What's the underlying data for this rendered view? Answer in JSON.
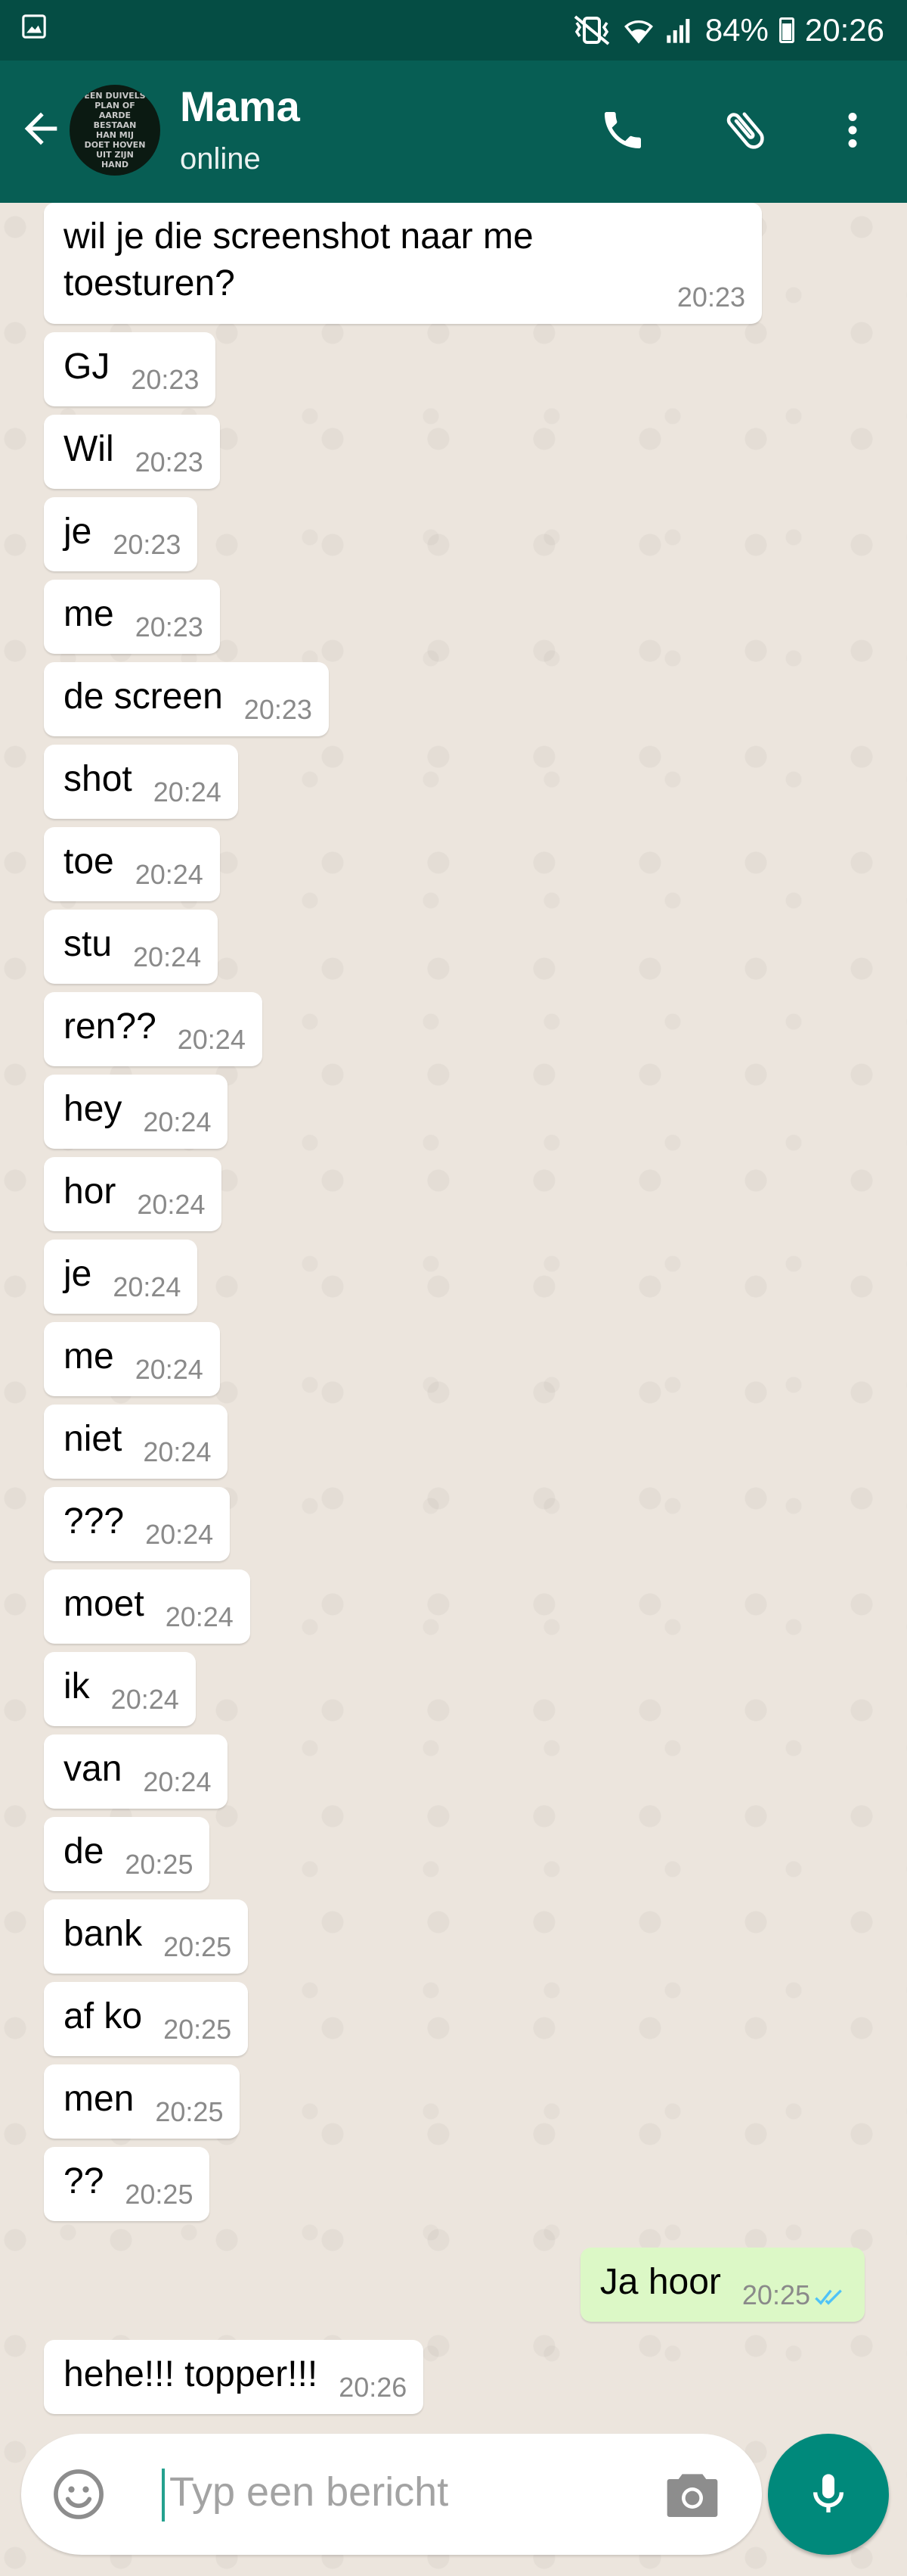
{
  "status_bar": {
    "battery": "84%",
    "time": "20:26"
  },
  "header": {
    "avatar_text": "EEN DUIVELS PLAN OF AARDE BESTAAN HAN MIJ DOET HOVEN UIT ZIJN HAND",
    "title": "Mama",
    "status": "online"
  },
  "messages": [
    {
      "dir": "in",
      "text": "wil je die screenshot naar me\ntoesturen?",
      "time": "20:23"
    },
    {
      "dir": "in",
      "text": "GJ",
      "time": "20:23"
    },
    {
      "dir": "in",
      "text": "Wil",
      "time": "20:23"
    },
    {
      "dir": "in",
      "text": "je",
      "time": "20:23"
    },
    {
      "dir": "in",
      "text": "me",
      "time": "20:23"
    },
    {
      "dir": "in",
      "text": "de screen",
      "time": "20:23"
    },
    {
      "dir": "in",
      "text": "shot",
      "time": "20:24"
    },
    {
      "dir": "in",
      "text": "toe",
      "time": "20:24"
    },
    {
      "dir": "in",
      "text": "stu",
      "time": "20:24"
    },
    {
      "dir": "in",
      "text": "ren??",
      "time": "20:24"
    },
    {
      "dir": "in",
      "text": "hey",
      "time": "20:24"
    },
    {
      "dir": "in",
      "text": "hor",
      "time": "20:24"
    },
    {
      "dir": "in",
      "text": "je",
      "time": "20:24"
    },
    {
      "dir": "in",
      "text": "me",
      "time": "20:24"
    },
    {
      "dir": "in",
      "text": "niet",
      "time": "20:24"
    },
    {
      "dir": "in",
      "text": "???",
      "time": "20:24"
    },
    {
      "dir": "in",
      "text": "moet",
      "time": "20:24"
    },
    {
      "dir": "in",
      "text": "ik",
      "time": "20:24"
    },
    {
      "dir": "in",
      "text": "van",
      "time": "20:24"
    },
    {
      "dir": "in",
      "text": "de",
      "time": "20:25"
    },
    {
      "dir": "in",
      "text": "bank",
      "time": "20:25"
    },
    {
      "dir": "in",
      "text": "af ko",
      "time": "20:25"
    },
    {
      "dir": "in",
      "text": "men",
      "time": "20:25"
    },
    {
      "dir": "in",
      "text": "??",
      "time": "20:25"
    },
    {
      "dir": "out",
      "text": "Ja hoor",
      "time": "20:25",
      "read": true
    },
    {
      "dir": "in",
      "text": "hehe!!! topper!!!",
      "time": "20:26"
    }
  ],
  "input": {
    "placeholder": "Typ een bericht"
  },
  "colors": {
    "header": "#075E54",
    "status_bar": "#054D44",
    "outgoing": "#DCF8C6",
    "accent": "#00897B",
    "read_ticks": "#4FC3F7"
  }
}
